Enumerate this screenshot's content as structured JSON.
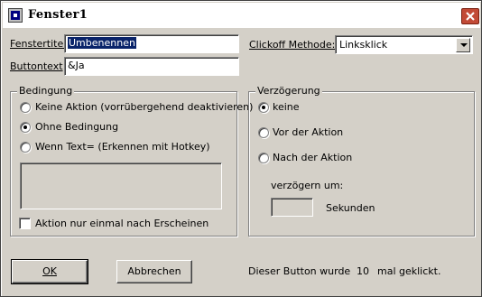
{
  "window": {
    "title": "Fenster1",
    "close_symbol": "×"
  },
  "fields": {
    "fenstertitel_label": "Fenstertitel",
    "fenstertitel_value": "Umbenennen",
    "buttontext_label": "Buttontext",
    "buttontext_value": "&Ja",
    "clickoff_label": "Clickoff Methode:",
    "clickoff_value": "Linksklick"
  },
  "bedingung": {
    "title": "Bedingung",
    "options": [
      {
        "label": "Keine Aktion (vorrübergehend deaktivieren)",
        "checked": false
      },
      {
        "label": "Ohne Bedingung",
        "checked": true
      },
      {
        "label": "Wenn Text= (Erkennen mit Hotkey)",
        "checked": false
      }
    ],
    "checkbox_label": "Aktion nur einmal nach Erscheinen",
    "checkbox_checked": false
  },
  "verzoegerung": {
    "title": "Verzögerung",
    "options": [
      {
        "label": "keine",
        "checked": true
      },
      {
        "label": "Vor der Aktion",
        "checked": false
      },
      {
        "label": "Nach der Aktion",
        "checked": false
      }
    ],
    "delay_label": "verzögern um:",
    "delay_value": "",
    "unit_label": "Sekunden"
  },
  "footer": {
    "ok_label": "OK",
    "cancel_label": "Abbrechen",
    "count_prefix": "Dieser Button wurde",
    "count_value": "10",
    "count_suffix": "mal geklickt."
  },
  "colors": {
    "face": "#d4d0c8",
    "title_bar": "#ffffff",
    "close_button": "#c24a36",
    "selection": "#0a246a"
  }
}
